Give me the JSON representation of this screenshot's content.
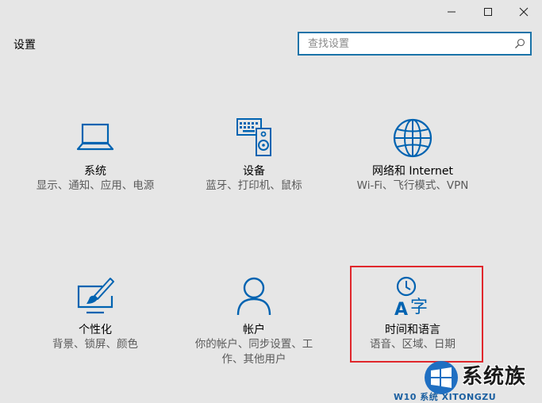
{
  "window": {
    "title": "设置",
    "controls": {
      "minimize": "minimize-icon",
      "maximize": "maximize-icon",
      "close": "close-icon"
    }
  },
  "search": {
    "placeholder": "查找设置",
    "value": ""
  },
  "tiles": [
    {
      "title": "系统",
      "desc": "显示、通知、应用、电源",
      "icon": "laptop-icon"
    },
    {
      "title": "设备",
      "desc": "蓝牙、打印机、鼠标",
      "icon": "devices-icon"
    },
    {
      "title": "网络和 Internet",
      "desc": "Wi-Fi、飞行模式、VPN",
      "icon": "globe-icon"
    },
    {
      "title": "个性化",
      "desc": "背景、锁屏、颜色",
      "icon": "personalization-icon"
    },
    {
      "title": "帐户",
      "desc": "你的帐户、同步设置、工作、其他用户",
      "icon": "person-icon"
    },
    {
      "title": "时间和语言",
      "desc": "语音、区域、日期",
      "icon": "time-language-icon"
    }
  ],
  "colors": {
    "accent": "#0063b1",
    "highlight": "#e0272c",
    "background": "#e6e6e6"
  },
  "watermark": {
    "brand": "系统族",
    "url": "W10 系统 XITONGZU"
  }
}
